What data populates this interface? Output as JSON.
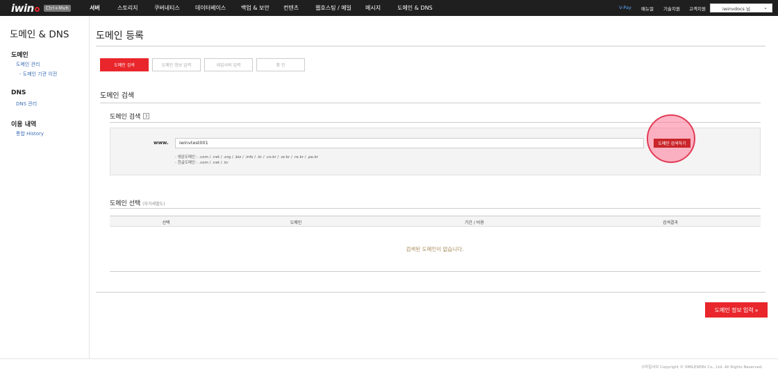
{
  "header": {
    "logo_text": "iwin",
    "logo_badge": "Ctrl+Mvh",
    "nav": [
      "서버",
      "스토리지",
      "쿠버네티스",
      "데이터베이스",
      "백업 & 보안",
      "컨텐츠",
      "웹호스팅 / 메일",
      "메시지",
      "도메인 & DNS"
    ],
    "right_links": [
      "V-Pay",
      "매뉴얼",
      "기술지원",
      "고객지원"
    ],
    "user": "iwinvdocs 님"
  },
  "sidebar": {
    "title": "도메인 & DNS",
    "groups": [
      {
        "label": "도메인",
        "links": [
          "도메인 관리",
          "- 도메인 기관 이전"
        ]
      },
      {
        "label": "DNS",
        "links": [
          "DNS 관리"
        ]
      },
      {
        "label": "이용 내역",
        "links": [
          "통합 History"
        ]
      }
    ]
  },
  "main": {
    "title": "도메인 등록",
    "steps": [
      "도메인 검색",
      "도메인 정보 입력",
      "네임서버 입력",
      "확 인"
    ],
    "section_title": "도메인 검색",
    "search": {
      "subtitle": "도메인 검색",
      "help": "?",
      "www_label": "www.",
      "input_value": "iwinvtest001",
      "button_label": "도메인 검색하기",
      "hints": [
        "- 영문도메인 : .com / .net / .org / .biz / .info / .kr / .co.kr / .or.kr / .re.kr / .pe.kr",
        "- 한글도메인 : .com / .net / .kr"
      ]
    },
    "select": {
      "subtitle": "도메인 선택",
      "note": "(부가세별도)",
      "columns": [
        "선택",
        "도메인",
        "기간 / 비용",
        "검색결과"
      ],
      "empty_message": "검색된 도메인이 없습니다."
    },
    "next_button": "도메인 정보 입력 »"
  },
  "footer": {
    "copyright": "스마일서브 Copyright © SMILESERV Co., Ltd. All Rights Reserved."
  },
  "colors": {
    "accent": "#e8262b",
    "link": "#3d6fb4",
    "topbar": "#1f1f1f",
    "highlight": "#e23a55"
  }
}
